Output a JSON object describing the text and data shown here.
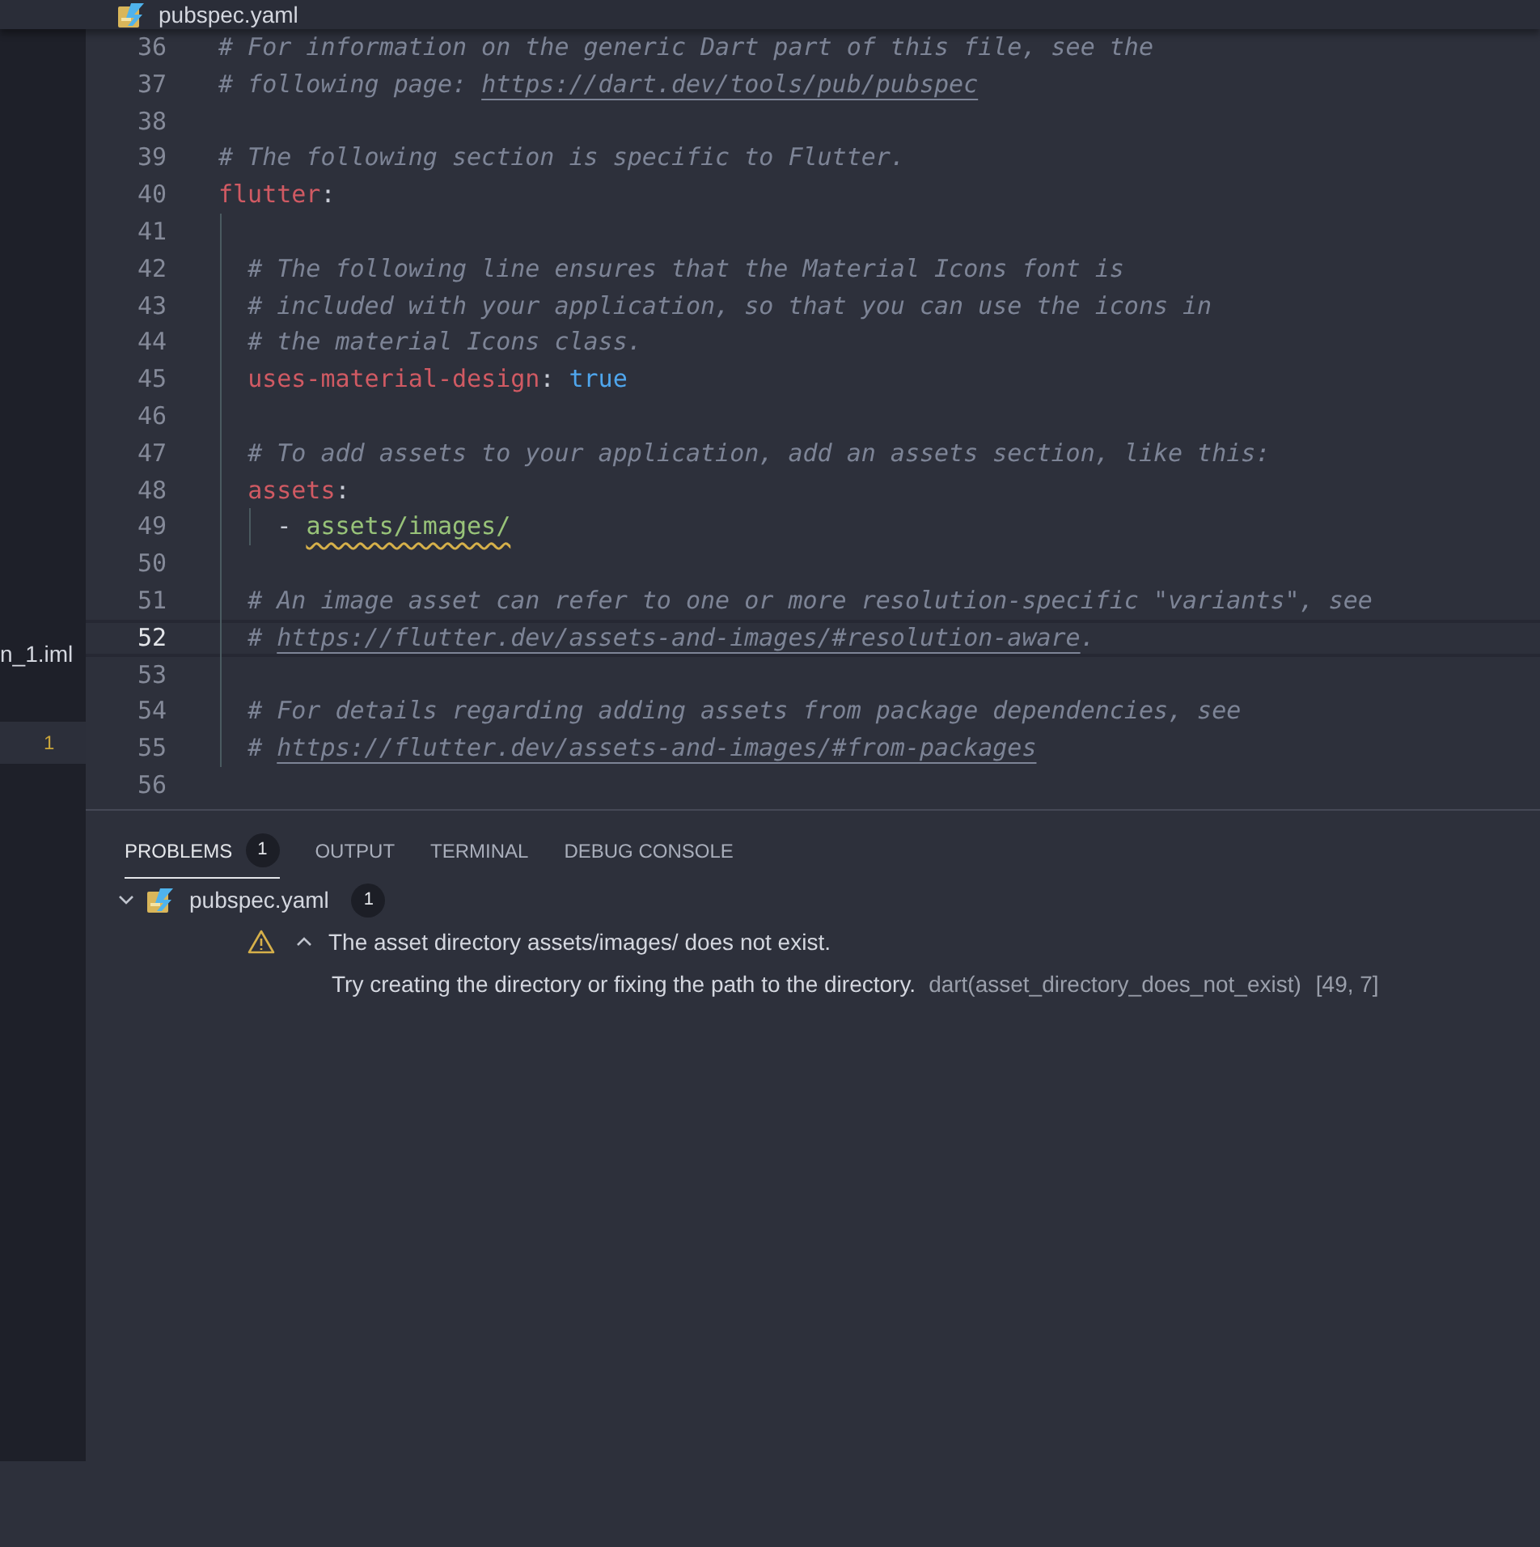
{
  "editor_tab": {
    "filename": "pubspec.yaml"
  },
  "sidebar": {
    "file_label": "n_1.iml",
    "problem_count": "1"
  },
  "lines": [
    {
      "number": "36",
      "current": false,
      "tokens": [
        {
          "kind": "comment",
          "text": "# For information on the generic Dart part of this file, see the"
        }
      ]
    },
    {
      "number": "37",
      "current": false,
      "tokens": [
        {
          "kind": "comment",
          "text": "# following page: "
        },
        {
          "kind": "link",
          "text": "https://dart.dev/tools/pub/pubspec"
        }
      ]
    },
    {
      "number": "38",
      "current": false
    },
    {
      "number": "39",
      "current": false,
      "tokens": [
        {
          "kind": "comment",
          "text": "# The following section is specific to Flutter."
        }
      ]
    },
    {
      "number": "40",
      "current": false,
      "tokens": [
        {
          "kind": "key",
          "text": "flutter"
        },
        {
          "kind": "punct",
          "text": ":"
        }
      ]
    },
    {
      "number": "41",
      "current": false
    },
    {
      "number": "42",
      "current": false,
      "tokens": [
        {
          "kind": "comment",
          "text": "  # The following line ensures that the Material Icons font is"
        }
      ]
    },
    {
      "number": "43",
      "current": false,
      "tokens": [
        {
          "kind": "comment",
          "text": "  # included with your application, so that you can use the icons in"
        }
      ]
    },
    {
      "number": "44",
      "current": false,
      "tokens": [
        {
          "kind": "comment",
          "text": "  # the material Icons class."
        }
      ]
    },
    {
      "number": "45",
      "current": false,
      "tokens": [
        {
          "kind": "key",
          "text": "  uses-material-design"
        },
        {
          "kind": "punct",
          "text": ": "
        },
        {
          "kind": "bool",
          "text": "true"
        }
      ]
    },
    {
      "number": "46",
      "current": false
    },
    {
      "number": "47",
      "current": false,
      "tokens": [
        {
          "kind": "comment",
          "text": "  # To add assets to your application, add an assets section, like this:"
        }
      ]
    },
    {
      "number": "48",
      "current": false,
      "tokens": [
        {
          "kind": "key",
          "text": "  assets"
        },
        {
          "kind": "punct",
          "text": ":"
        }
      ]
    },
    {
      "number": "49",
      "current": false,
      "tokens": [
        {
          "kind": "punct",
          "text": "    - "
        },
        {
          "kind": "string",
          "text": "assets/images/",
          "warning": true
        }
      ]
    },
    {
      "number": "50",
      "current": false
    },
    {
      "number": "51",
      "current": false,
      "tokens": [
        {
          "kind": "comment",
          "text": "  # An image asset can refer to one or more resolution-specific \"variants\", see"
        }
      ]
    },
    {
      "number": "52",
      "current": true,
      "tokens": [
        {
          "kind": "comment",
          "text": "  # "
        },
        {
          "kind": "link",
          "text": "https://flutter.dev/assets-and-images/#resolution-aware"
        },
        {
          "kind": "comment",
          "text": "."
        }
      ]
    },
    {
      "number": "53",
      "current": false
    },
    {
      "number": "54",
      "current": false,
      "tokens": [
        {
          "kind": "comment",
          "text": "  # For details regarding adding assets from package dependencies, see"
        }
      ]
    },
    {
      "number": "55",
      "current": false,
      "tokens": [
        {
          "kind": "comment",
          "text": "  # "
        },
        {
          "kind": "link",
          "text": "https://flutter.dev/assets-and-images/#from-packages"
        }
      ]
    },
    {
      "number": "56",
      "current": false
    }
  ],
  "panel": {
    "tabs": [
      {
        "label": "PROBLEMS",
        "badge": "1",
        "selected": true
      },
      {
        "label": "OUTPUT",
        "selected": false
      },
      {
        "label": "TERMINAL",
        "selected": false
      },
      {
        "label": "DEBUG CONSOLE",
        "selected": false
      }
    ],
    "files": [
      {
        "name": "pubspec.yaml",
        "count": "1",
        "expanded": true,
        "problems": [
          {
            "kind": "warning",
            "expanded": true,
            "message": "The asset directory assets/images/ does not exist.",
            "detail": "Try creating the directory or fixing the path to the directory.",
            "source": "dart(asset_directory_does_not_exist)",
            "location": "[49, 7]"
          }
        ]
      }
    ]
  }
}
